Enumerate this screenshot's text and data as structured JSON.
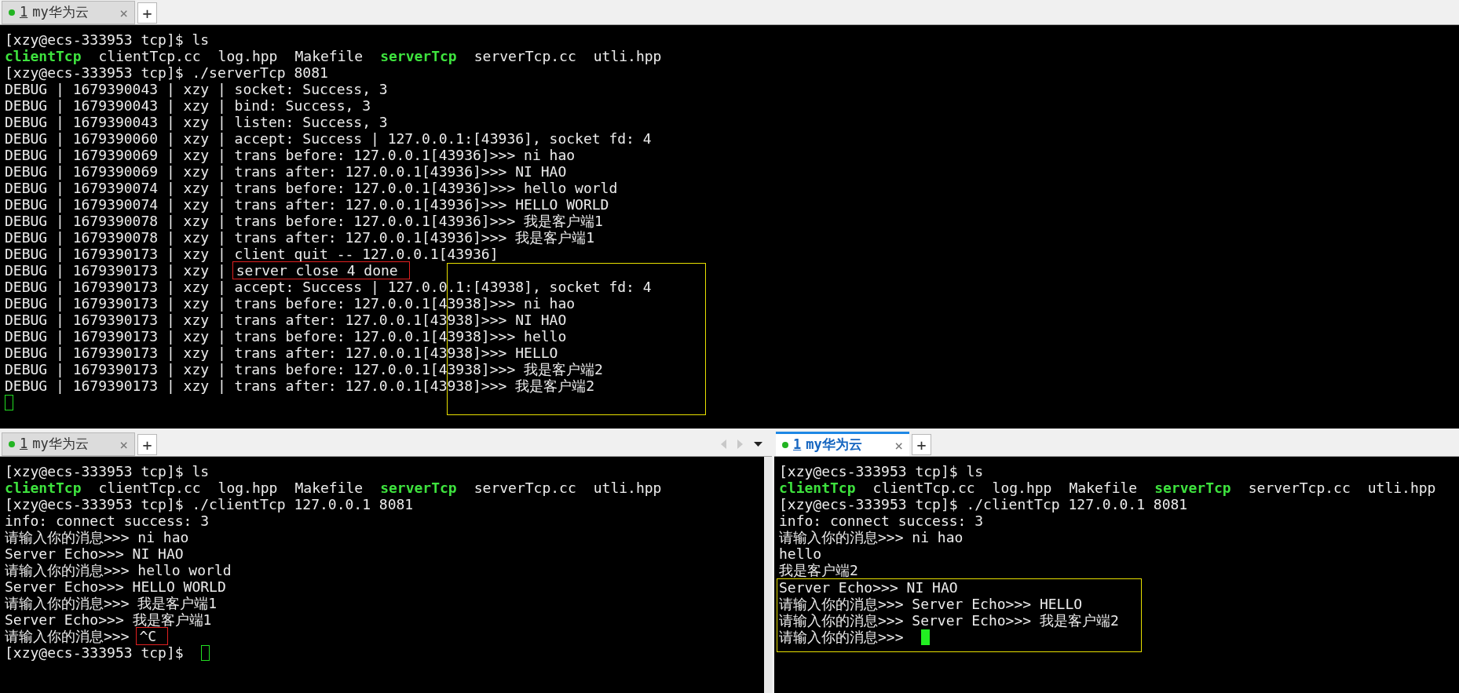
{
  "panes": [
    {
      "tabs": [
        {
          "index": "1",
          "title": "my华为云",
          "close": "×",
          "selected": false
        }
      ],
      "add_tab": "+",
      "nav_controls": false,
      "lines": [
        {
          "kind": "line",
          "segments": [
            {
              "text": "[xzy@ecs-333953 tcp]$ ls",
              "kind": "plain"
            }
          ]
        },
        {
          "kind": "line",
          "segments": [
            {
              "text": "clientTcp",
              "kind": "exe"
            },
            {
              "text": "clientTcp.cc",
              "kind": "plain"
            },
            {
              "text": "log.hpp",
              "kind": "plain"
            },
            {
              "text": "Makefile",
              "kind": "plain"
            },
            {
              "text": "serverTcp",
              "kind": "exe"
            },
            {
              "text": "serverTcp.cc",
              "kind": "plain"
            },
            {
              "text": "utli.hpp",
              "kind": "plain"
            }
          ]
        },
        {
          "kind": "line",
          "segments": [
            {
              "text": "[xzy@ecs-333953 tcp]$ ./serverTcp 8081",
              "kind": "plain"
            }
          ]
        },
        {
          "kind": "line",
          "segments": [
            {
              "text": "DEBUG | 1679390043 | xzy | socket: Success, 3",
              "kind": "plain"
            }
          ]
        },
        {
          "kind": "line",
          "segments": [
            {
              "text": "DEBUG | 1679390043 | xzy | bind: Success, 3",
              "kind": "plain"
            }
          ]
        },
        {
          "kind": "line",
          "segments": [
            {
              "text": "DEBUG | 1679390043 | xzy | listen: Success, 3",
              "kind": "plain"
            }
          ]
        },
        {
          "kind": "line",
          "segments": [
            {
              "text": "DEBUG | 1679390060 | xzy | accept: Success | 127.0.0.1:[43936], socket fd: 4",
              "kind": "plain"
            }
          ]
        },
        {
          "kind": "line",
          "segments": [
            {
              "text": "DEBUG | 1679390069 | xzy | trans before: 127.0.0.1[43936]>>> ni hao",
              "kind": "plain"
            }
          ]
        },
        {
          "kind": "line",
          "segments": [
            {
              "text": "DEBUG | 1679390069 | xzy | trans after: 127.0.0.1[43936]>>> NI HAO",
              "kind": "plain"
            }
          ]
        },
        {
          "kind": "line",
          "segments": [
            {
              "text": "DEBUG | 1679390074 | xzy | trans before: 127.0.0.1[43936]>>> hello world",
              "kind": "plain"
            }
          ]
        },
        {
          "kind": "line",
          "segments": [
            {
              "text": "DEBUG | 1679390074 | xzy | trans after: 127.0.0.1[43936]>>> HELLO WORLD",
              "kind": "plain"
            }
          ]
        },
        {
          "kind": "line",
          "segments": [
            {
              "text": "DEBUG | 1679390078 | xzy | trans before: 127.0.0.1[43936]>>> 我是客户端1",
              "kind": "plain"
            }
          ]
        },
        {
          "kind": "line",
          "segments": [
            {
              "text": "DEBUG | 1679390078 | xzy | trans after: 127.0.0.1[43936]>>> 我是客户端1",
              "kind": "plain"
            }
          ]
        },
        {
          "kind": "line",
          "segments": [
            {
              "text": "DEBUG | 1679390173 | xzy | client quit -- 127.0.0.1[43936]",
              "kind": "plain"
            }
          ]
        },
        {
          "kind": "line",
          "segments": [
            {
              "text": "DEBUG | 1679390173 | xzy |",
              "kind": "plain"
            },
            {
              "text": "server close 4 done",
              "kind": "boxed"
            }
          ]
        },
        {
          "kind": "frame",
          "lines": [
            {
              "kind": "line",
              "segments": [
                {
                  "text": "DEBUG | 1679390173 | xzy | accept: Success | 127.0.0.1:[43938], socket fd: 4",
                  "kind": "plain"
                }
              ]
            },
            {
              "kind": "line",
              "segments": [
                {
                  "text": "DEBUG | 1679390173 | xzy | trans before: 127.0.0.1[43938]>>> ni hao",
                  "kind": "plain"
                }
              ]
            },
            {
              "kind": "line",
              "segments": [
                {
                  "text": "DEBUG | 1679390173 | xzy | trans after: 127.0.0.1[43938]>>> NI HAO",
                  "kind": "plain"
                }
              ]
            },
            {
              "kind": "line",
              "segments": [
                {
                  "text": "DEBUG | 1679390173 | xzy | trans before: 127.0.0.1[43938]>>> hello",
                  "kind": "plain"
                }
              ]
            },
            {
              "kind": "line",
              "segments": [
                {
                  "text": "DEBUG | 1679390173 | xzy | trans after: 127.0.0.1[43938]>>> HELLO",
                  "kind": "plain"
                }
              ]
            },
            {
              "kind": "line",
              "segments": [
                {
                  "text": "DEBUG | 1679390173 | xzy | trans before: 127.0.0.1[43938]>>> 我是客户端2",
                  "kind": "plain"
                }
              ]
            },
            {
              "kind": "line",
              "segments": [
                {
                  "text": "DEBUG | 1679390173 | xzy | trans after: 127.0.0.1[43938]>>> 我是客户端2",
                  "kind": "plain"
                }
              ]
            },
            {
              "kind": "line",
              "cursor": true
            }
          ]
        }
      ]
    },
    {
      "tabs": [
        {
          "index": "1",
          "title": "my华为云",
          "close": "×",
          "selected": false
        }
      ],
      "add_tab": "+",
      "nav_controls": true,
      "lines": [
        {
          "kind": "line",
          "segments": [
            {
              "text": "[xzy@ecs-333953 tcp]$ ls",
              "kind": "plain"
            }
          ]
        },
        {
          "kind": "line",
          "segments": [
            {
              "text": "clientTcp",
              "kind": "exe"
            },
            {
              "text": "clientTcp.cc",
              "kind": "plain"
            },
            {
              "text": "log.hpp",
              "kind": "plain"
            },
            {
              "text": "Makefile",
              "kind": "plain"
            },
            {
              "text": "serverTcp",
              "kind": "exe"
            },
            {
              "text": "serverTcp.cc",
              "kind": "plain"
            },
            {
              "text": "utli.hpp",
              "kind": "plain"
            }
          ]
        },
        {
          "kind": "line",
          "segments": [
            {
              "text": "[xzy@ecs-333953 tcp]$ ./clientTcp 127.0.0.1 8081",
              "kind": "plain"
            }
          ]
        },
        {
          "kind": "line",
          "segments": [
            {
              "text": "info: connect success: 3",
              "kind": "plain"
            }
          ]
        },
        {
          "kind": "line",
          "segments": [
            {
              "text": "请输入你的消息>>> ni hao",
              "kind": "plain"
            }
          ]
        },
        {
          "kind": "line",
          "segments": [
            {
              "text": "Server Echo>>> NI HAO",
              "kind": "plain"
            }
          ]
        },
        {
          "kind": "line",
          "segments": [
            {
              "text": "请输入你的消息>>> hello world",
              "kind": "plain"
            }
          ]
        },
        {
          "kind": "line",
          "segments": [
            {
              "text": "Server Echo>>> HELLO WORLD",
              "kind": "plain"
            }
          ]
        },
        {
          "kind": "line",
          "segments": [
            {
              "text": "请输入你的消息>>> 我是客户端1",
              "kind": "plain"
            }
          ]
        },
        {
          "kind": "line",
          "segments": [
            {
              "text": "Server Echo>>> 我是客户端1",
              "kind": "plain"
            }
          ]
        },
        {
          "kind": "line",
          "segments": [
            {
              "text": "请输入你的消息>>>",
              "kind": "plain"
            },
            {
              "text": "^C",
              "kind": "boxed"
            }
          ]
        },
        {
          "kind": "line",
          "cursor": true,
          "segments": [
            {
              "text": "[xzy@ecs-333953 tcp]$",
              "kind": "plain"
            }
          ]
        }
      ]
    },
    {
      "tabs": [
        {
          "index": "1",
          "title": "my华为云",
          "close": "×",
          "selected": true
        }
      ],
      "add_tab": "+",
      "nav_controls": false,
      "lines": [
        {
          "kind": "line",
          "segments": [
            {
              "text": "[xzy@ecs-333953 tcp]$ ls",
              "kind": "plain"
            }
          ]
        },
        {
          "kind": "line",
          "segments": [
            {
              "text": "clientTcp",
              "kind": "exe"
            },
            {
              "text": "clientTcp.cc",
              "kind": "plain"
            },
            {
              "text": "log.hpp",
              "kind": "plain"
            },
            {
              "text": "Makefile",
              "kind": "plain"
            },
            {
              "text": "serverTcp",
              "kind": "exe"
            },
            {
              "text": "serverTcp.cc",
              "kind": "plain"
            },
            {
              "text": "utli.hpp",
              "kind": "plain"
            }
          ]
        },
        {
          "kind": "line",
          "segments": [
            {
              "text": "[xzy@ecs-333953 tcp]$ ./clientTcp 127.0.0.1 8081",
              "kind": "plain"
            }
          ]
        },
        {
          "kind": "line",
          "segments": [
            {
              "text": "info: connect success: 3",
              "kind": "plain"
            }
          ]
        },
        {
          "kind": "line",
          "segments": [
            {
              "text": "请输入你的消息>>> ni hao",
              "kind": "plain"
            }
          ]
        },
        {
          "kind": "line",
          "segments": [
            {
              "text": "hello",
              "kind": "plain"
            }
          ]
        },
        {
          "kind": "line",
          "segments": [
            {
              "text": "我是客户端2",
              "kind": "plain"
            }
          ]
        },
        {
          "kind": "frame",
          "lines": [
            {
              "kind": "line",
              "segments": [
                {
                  "text": "Server Echo>>> NI HAO",
                  "kind": "plain"
                }
              ]
            },
            {
              "kind": "line",
              "segments": [
                {
                  "text": "请输入你的消息>>> Server Echo>>> HELLO",
                  "kind": "plain"
                }
              ]
            },
            {
              "kind": "line",
              "segments": [
                {
                  "text": "请输入你的消息>>> Server Echo>>> 我是客户端2",
                  "kind": "plain"
                }
              ]
            },
            {
              "kind": "line",
              "cursor": true,
              "segments": [
                {
                  "text": "请输入你的消息>>>",
                  "kind": "plain"
                }
              ]
            }
          ]
        }
      ]
    }
  ]
}
